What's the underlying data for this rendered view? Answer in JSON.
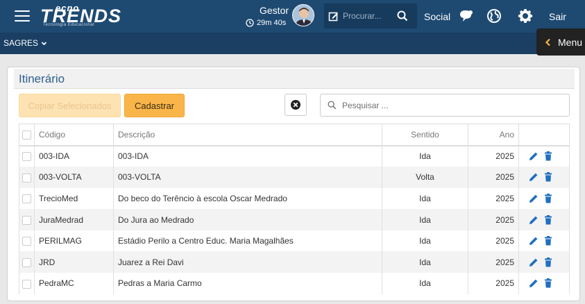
{
  "header": {
    "logo": {
      "top": "ecno",
      "main": "TRENDS",
      "sub": "Tecnologia Educacional"
    },
    "user_name": "Gestor",
    "timer": "29m 40s",
    "search_placeholder": "Procurar...",
    "social_label": "Social",
    "logout_label": "Sair"
  },
  "subheader": {
    "module": "SAGRES",
    "menu_label": "Menu"
  },
  "page": {
    "title": "Itinerário",
    "copy_button": "Copiar Selecionados",
    "create_button": "Cadastrar",
    "search_placeholder": "Pesquisar ..."
  },
  "table": {
    "headers": [
      "Código",
      "Descrição",
      "Sentido",
      "Ano"
    ],
    "rows": [
      {
        "codigo": "003-IDA",
        "descricao": "003-IDA",
        "sentido": "Ida",
        "ano": "2025"
      },
      {
        "codigo": "003-VOLTA",
        "descricao": "003-VOLTA",
        "sentido": "Volta",
        "ano": "2025"
      },
      {
        "codigo": "TrecioMed",
        "descricao": "Do beco do Terêncio à escola Oscar Medrado",
        "sentido": "Ida",
        "ano": "2025"
      },
      {
        "codigo": "JuraMedrad",
        "descricao": "Do Jura ao Medrado",
        "sentido": "Ida",
        "ano": "2025"
      },
      {
        "codigo": "PERILMAG",
        "descricao": "Estádio Perilo a Centro Educ. Maria Magalhães",
        "sentido": "Ida",
        "ano": "2025"
      },
      {
        "codigo": "JRD",
        "descricao": "Juarez a Rei Davi",
        "sentido": "Ida",
        "ano": "2025"
      },
      {
        "codigo": "PedraMC",
        "descricao": "Pedras a Maria Carmo",
        "sentido": "Ida",
        "ano": "2025"
      }
    ]
  },
  "colors": {
    "topbar": "#1e4a72",
    "subbar": "#1a3f63",
    "accent": "#f9b54a",
    "title": "#2d5f8f",
    "edit_icon": "#1f6fc1",
    "delete_icon": "#1f6fc1"
  },
  "icons": [
    "menu-icon",
    "clock-icon",
    "edit-note-icon",
    "search-icon",
    "chat-icon",
    "globe-icon",
    "gear-icon",
    "chevron-down-icon",
    "chevron-left-icon",
    "close-circle-icon",
    "pencil-icon",
    "trash-icon"
  ]
}
